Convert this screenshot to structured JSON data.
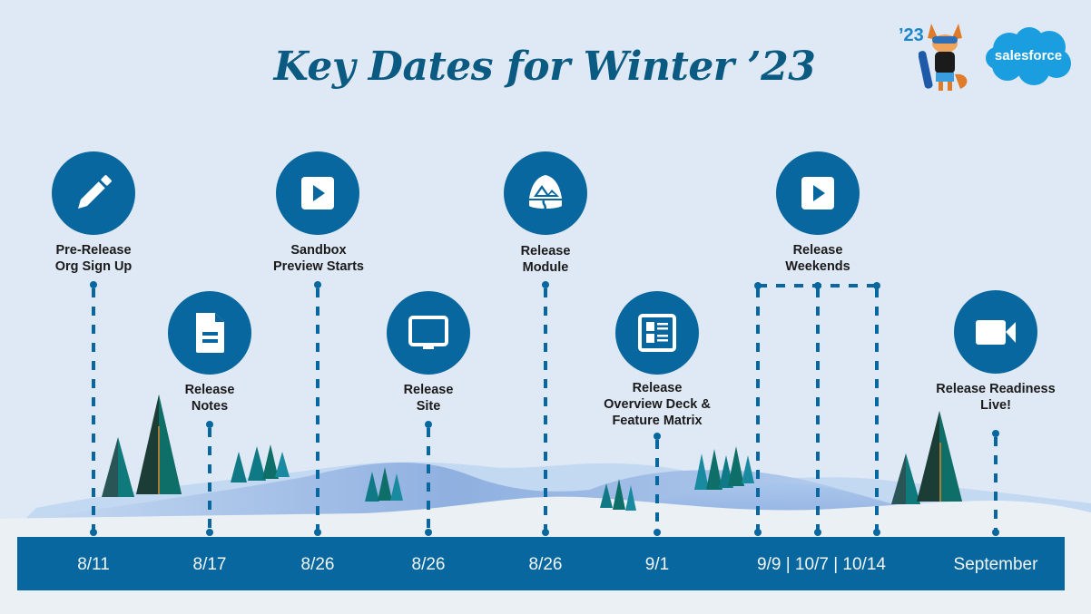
{
  "title": "Key Dates for Winter ’23",
  "branding": {
    "year_tag": "’23",
    "logo_text": "salesforce",
    "mascot": "fox-snowboarder-mascot"
  },
  "colors": {
    "background": "#dfe9f6",
    "accent": "#07679e",
    "title": "#0b5a82",
    "logo_blue": "#1b9ee0",
    "snow": "#ebf0f5"
  },
  "milestones": [
    {
      "label_line1": "Pre-Release",
      "label_line2": "Org Sign Up",
      "label_line3": "",
      "date": "8/11",
      "icon": "pencil-icon"
    },
    {
      "label_line1": "Release",
      "label_line2": "Notes",
      "label_line3": "",
      "date": "8/17",
      "icon": "document-icon"
    },
    {
      "label_line1": "Sandbox",
      "label_line2": "Preview Starts",
      "label_line3": "",
      "date": "8/26",
      "icon": "play-icon"
    },
    {
      "label_line1": "Release",
      "label_line2": "Site",
      "label_line3": "",
      "date": "8/26",
      "icon": "monitor-icon"
    },
    {
      "label_line1": "Release",
      "label_line2": "Module",
      "label_line3": "",
      "date": "8/26",
      "icon": "trailhead-mountain-icon"
    },
    {
      "label_line1": "Release",
      "label_line2": "Overview Deck &",
      "label_line3": "Feature Matrix",
      "date": "9/1",
      "icon": "article-layout-icon"
    },
    {
      "label_line1": "Release",
      "label_line2": "Weekends",
      "label_line3": "",
      "date": "9/9 | 10/7 | 10/14",
      "icon": "play-icon"
    },
    {
      "label_line1": "Release Readiness",
      "label_line2": "Live!",
      "label_line3": "",
      "date": "September",
      "icon": "video-camera-icon"
    }
  ]
}
